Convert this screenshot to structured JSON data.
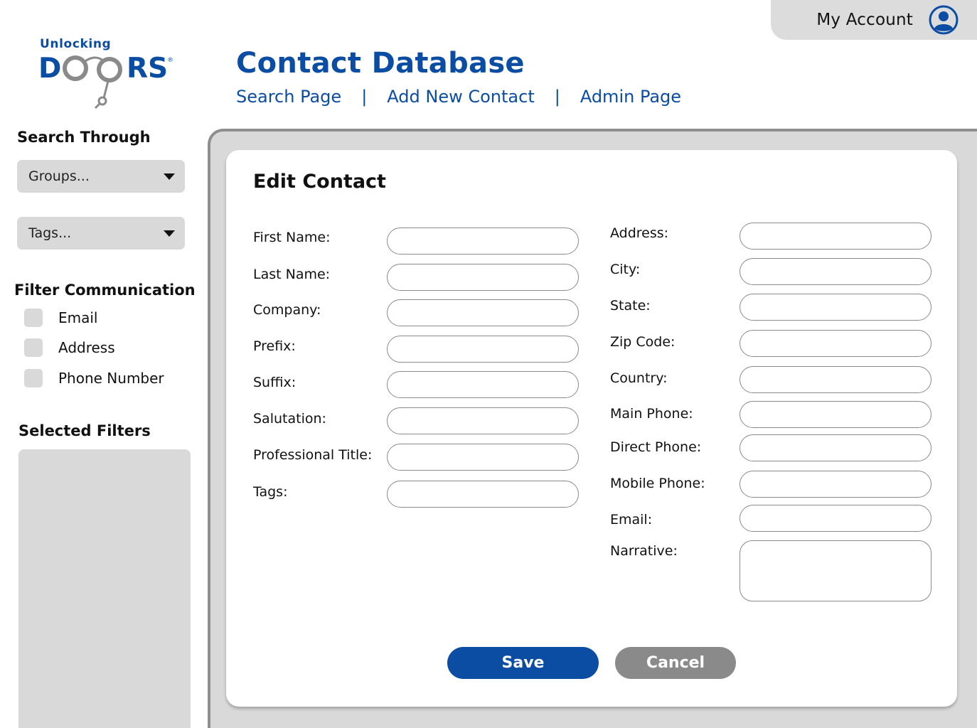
{
  "account": {
    "label": "My Account",
    "icon": "user-circle-icon"
  },
  "logo": {
    "line1": "Unlocking",
    "letter_d": "D",
    "letters_rs": "RS",
    "registered": "®"
  },
  "header": {
    "title": "Contact Database",
    "nav": [
      {
        "label": "Search Page"
      },
      {
        "label": "Add New Contact"
      },
      {
        "label": "Admin Page"
      }
    ],
    "separator": "|"
  },
  "sidebar": {
    "search_heading": "Search Through",
    "groups_dropdown": "Groups...",
    "tags_dropdown": "Tags...",
    "filter_heading": "Filter Communication",
    "filters": [
      {
        "label": "Email"
      },
      {
        "label": "Address"
      },
      {
        "label": "Phone Number"
      }
    ],
    "selected_heading": "Selected Filters"
  },
  "form": {
    "title": "Edit Contact",
    "left_fields": [
      {
        "label": "First Name:",
        "value": ""
      },
      {
        "label": "Last Name:",
        "value": ""
      },
      {
        "label": "Company:",
        "value": ""
      },
      {
        "label": "Prefix:",
        "value": ""
      },
      {
        "label": "Suffix:",
        "value": ""
      },
      {
        "label": "Salutation:",
        "value": ""
      },
      {
        "label": "Professional Title:",
        "value": ""
      },
      {
        "label": "Tags:",
        "value": ""
      }
    ],
    "right_fields": [
      {
        "label": "Address:",
        "value": ""
      },
      {
        "label": "City:",
        "value": ""
      },
      {
        "label": "State:",
        "value": ""
      },
      {
        "label": "Zip Code:",
        "value": ""
      },
      {
        "label": "Country:",
        "value": ""
      },
      {
        "label": "Main Phone:",
        "value": ""
      },
      {
        "label": "Direct Phone:",
        "value": ""
      },
      {
        "label": "Mobile Phone:",
        "value": ""
      },
      {
        "label": "Email:",
        "value": ""
      }
    ],
    "narrative": {
      "label": "Narrative:",
      "value": ""
    },
    "save_label": "Save",
    "cancel_label": "Cancel"
  },
  "colors": {
    "brand": "#0b4da2",
    "panel": "#d9d9d9",
    "cancel": "#8a8a8a"
  }
}
